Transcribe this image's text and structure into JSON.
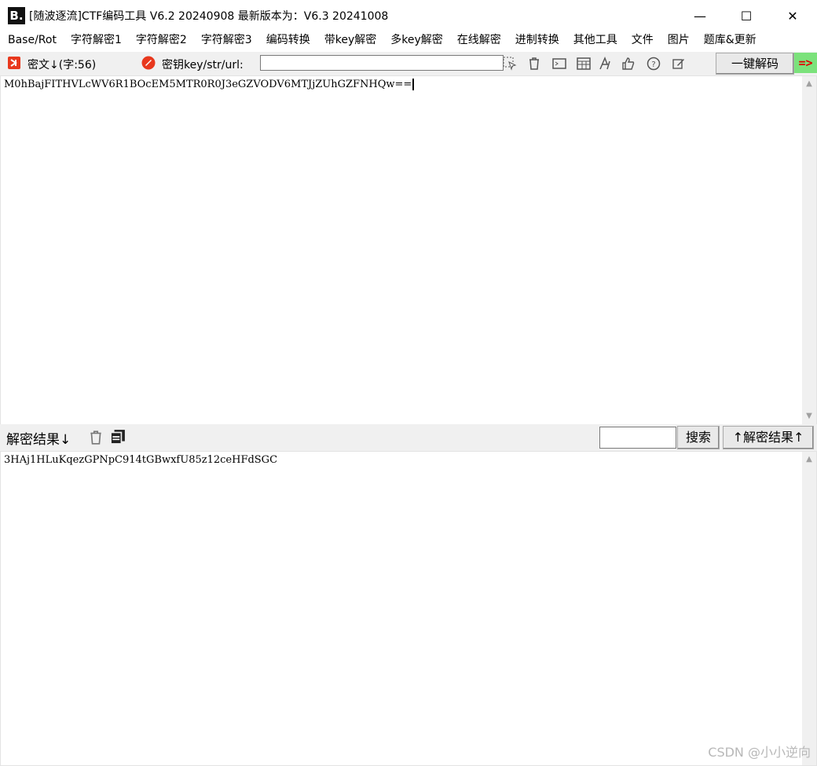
{
  "window": {
    "logo": "B.",
    "title": "[随波逐流]CTF编码工具 V6.2 20240908    最新版本为：V6.3 20241008",
    "minimize": "—",
    "maximize": "☐",
    "close": "✕"
  },
  "menu": [
    "Base/Rot",
    "字符解密1",
    "字符解密2",
    "字符解密3",
    "编码转换",
    "带key解密",
    "多key解密",
    "在线解密",
    "进制转换",
    "其他工具",
    "文件",
    "图片",
    "题库&更新"
  ],
  "toolbar": {
    "cipher_label": "密文↓(字:56)",
    "key_label": "密钥key/str/url:",
    "key_value": "",
    "decode_button": "一键解码",
    "arrow": "=>"
  },
  "cipher_text": "M0hBajFITHVLcWV6R1BOcEM5MTR0R0J3eGZVODV6MTJjZUhGZFNHQw==",
  "result_bar": {
    "label": "解密结果↓",
    "search_value": "",
    "search_button": "搜索",
    "up_button": "↑解密结果↑"
  },
  "result_text": "3HAj1HLuKqezGPNpC914tGBwxfU85z12ceHFdSGC",
  "watermark": "CSDN @小小逆向",
  "colors": {
    "toolbar_bg": "#f0f0f0",
    "arrow_bg": "#7be27b",
    "arrow_fg": "#e00000",
    "icon_red": "#e8381d"
  }
}
